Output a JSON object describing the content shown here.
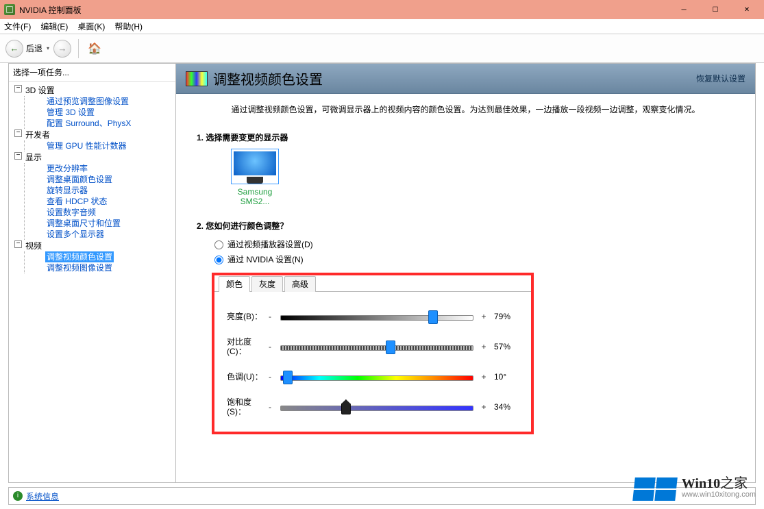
{
  "window": {
    "title": "NVIDIA 控制面板"
  },
  "menu": {
    "file": "文件(F)",
    "edit": "编辑(E)",
    "desktop": "桌面(K)",
    "help": "帮助(H)"
  },
  "toolbar": {
    "back": "后退"
  },
  "left": {
    "task_label": "选择一项任务...",
    "n3d": {
      "label": "3D 设置",
      "items": [
        "通过预览调整图像设置",
        "管理 3D 设置",
        "配置 Surround、PhysX"
      ]
    },
    "dev": {
      "label": "开发者",
      "items": [
        "管理 GPU 性能计数器"
      ]
    },
    "display": {
      "label": "显示",
      "items": [
        "更改分辨率",
        "调整桌面颜色设置",
        "旋转显示器",
        "查看 HDCP 状态",
        "设置数字音频",
        "调整桌面尺寸和位置",
        "设置多个显示器"
      ]
    },
    "video": {
      "label": "视频",
      "items": [
        "调整视频颜色设置",
        "调整视频图像设置"
      ]
    }
  },
  "right": {
    "title": "调整视频颜色设置",
    "restore": "恢复默认设置",
    "desc": "通过调整视频颜色设置，可微调显示器上的视频内容的颜色设置。为达到最佳效果，一边播放一段视频一边调整，观察变化情况。",
    "step1": "1. 选择需要变更的显示器",
    "monitor_name": "Samsung SMS2...",
    "step2": "2. 您如何进行颜色调整？",
    "radio_player": "通过视频播放器设置(D)",
    "radio_nvidia": "通过 NVIDIA 设置(N)",
    "tabs": {
      "color": "颜色",
      "gamma": "灰度",
      "advanced": "高级"
    },
    "sliders": {
      "brightness": {
        "label": "亮度(B)：",
        "value": "79%",
        "pos": 79
      },
      "contrast": {
        "label": "对比度(C)：",
        "value": "57%",
        "pos": 57
      },
      "hue": {
        "label": "色调(U)：",
        "value": "10°",
        "pos": 4
      },
      "saturation": {
        "label": "饱和度(S)：",
        "value": "34%",
        "pos": 34
      }
    }
  },
  "status": {
    "sysinfo": "系统信息"
  },
  "watermark": {
    "brand_b": "Win10",
    "brand_rest": "之家",
    "url": "www.win10xitong.com"
  }
}
